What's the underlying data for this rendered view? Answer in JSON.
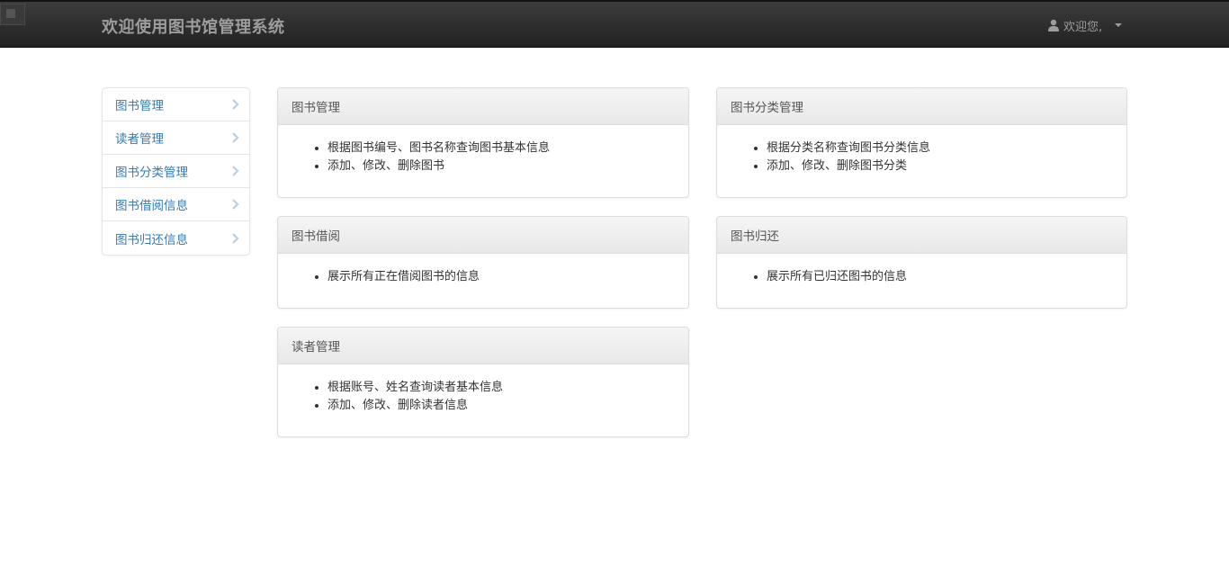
{
  "header": {
    "title": "欢迎使用图书馆管理系统",
    "welcome": "欢迎您,"
  },
  "sidebar": {
    "items": [
      {
        "label": "图书管理"
      },
      {
        "label": "读者管理"
      },
      {
        "label": "图书分类管理"
      },
      {
        "label": "图书借阅信息"
      },
      {
        "label": "图书归还信息"
      }
    ]
  },
  "panels": {
    "book": {
      "title": "图书管理",
      "items": [
        "根据图书编号、图书名称查询图书基本信息",
        "添加、修改、删除图书"
      ]
    },
    "category": {
      "title": "图书分类管理",
      "items": [
        "根据分类名称查询图书分类信息",
        "添加、修改、删除图书分类"
      ]
    },
    "borrow": {
      "title": "图书借阅",
      "items": [
        "展示所有正在借阅图书的信息"
      ]
    },
    "return": {
      "title": "图书归还",
      "items": [
        "展示所有已归还图书的信息"
      ]
    },
    "reader": {
      "title": "读者管理",
      "items": [
        "根据账号、姓名查询读者基本信息",
        "添加、修改、删除读者信息"
      ]
    }
  },
  "colors": {
    "navbar": "#222222",
    "link": "#337ab7",
    "muted": "#9d9d9d"
  },
  "icons": {
    "user": "user-icon",
    "chevron": "chevron-right-icon",
    "caret": "caret-down-icon"
  }
}
